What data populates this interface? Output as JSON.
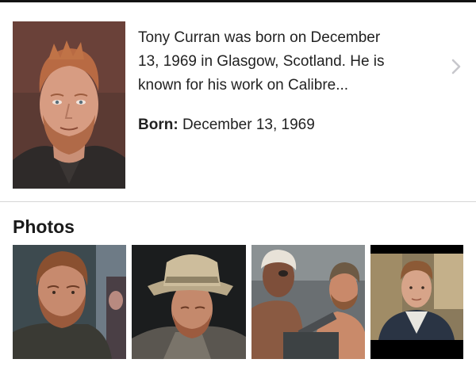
{
  "bio": {
    "summary_line1": "Tony Curran was born on December",
    "summary_line2": "13, 1969 in Glasgow, Scotland. He is",
    "summary_line3": "known for his work on Calibre...",
    "born_label": "Born:",
    "born_value": "December 13, 1969",
    "expand_icon": "chevron-right-icon"
  },
  "photos": {
    "title": "Photos",
    "items": [
      {
        "icon": "photo-thumbnail"
      },
      {
        "icon": "photo-thumbnail"
      },
      {
        "icon": "photo-thumbnail"
      },
      {
        "icon": "photo-thumbnail"
      }
    ]
  },
  "colors": {
    "divider": "#d6d6d6",
    "chevron": "#c7c7cc",
    "text": "#222222"
  }
}
